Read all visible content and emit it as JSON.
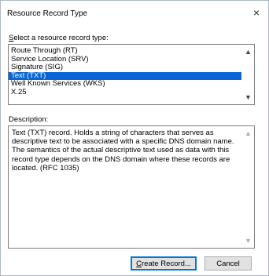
{
  "window": {
    "title": "Resource Record Type",
    "close_glyph": "×"
  },
  "select_label": {
    "hotkey": "S",
    "rest": "elect a resource record type:"
  },
  "record_types": [
    {
      "label": "Route Through (RT)",
      "selected": false
    },
    {
      "label": "Service Location (SRV)",
      "selected": false
    },
    {
      "label": "Signature (SIG)",
      "selected": false
    },
    {
      "label": "Text (TXT)",
      "selected": true
    },
    {
      "label": "Well Known Services (WKS)",
      "selected": false
    },
    {
      "label": "X.25",
      "selected": false
    }
  ],
  "scroll": {
    "up_icon": "chevron-up-icon",
    "down_icon": "chevron-down-icon"
  },
  "description": {
    "label": "Description:",
    "text": "Text (TXT) record. Holds a string of characters that serves as descriptive text to be associated with a specific DNS domain name. The semantics of the actual descriptive text used as data with this record type depends on the DNS domain where these records are located. (RFC 1035)"
  },
  "buttons": {
    "create_hotkey": "C",
    "create_rest": "reate Record...",
    "cancel": "Cancel"
  },
  "colors": {
    "selection": "#0a64d6",
    "default_button_border": "#0078d7"
  }
}
